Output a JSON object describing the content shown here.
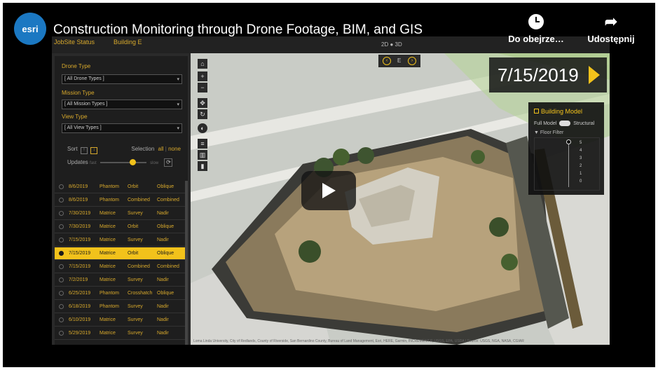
{
  "video": {
    "title": "Construction Monitoring through Drone Footage, BIM, and GIS",
    "logo_text": "esri",
    "watch_later_label": "Do obejrze…",
    "share_label": "Udostępnij"
  },
  "app": {
    "subtitle_left": "JobSite Status",
    "subtitle_right": "Building E",
    "view_toggle": "2D ● 3D"
  },
  "filters": [
    {
      "label": "Drone Type",
      "value": "[ All Drone Types ]"
    },
    {
      "label": "Mission Type",
      "value": "[ All Mission Types ]"
    },
    {
      "label": "View Type",
      "value": "[ All View Types ]"
    }
  ],
  "sort": {
    "label": "Sort",
    "selection_label": "Selection",
    "all": "all",
    "none": "none",
    "updates_label": "Updates",
    "updates_left": "fast",
    "updates_right": "slow",
    "updates_level": 0.7
  },
  "table_rows": [
    {
      "date": "8/6/2019",
      "drone": "Phantom",
      "mission": "Orbit",
      "view": "Oblique",
      "selected": false
    },
    {
      "date": "8/6/2019",
      "drone": "Phantom",
      "mission": "Combined",
      "view": "Combined",
      "selected": false
    },
    {
      "date": "7/30/2019",
      "drone": "Matrice",
      "mission": "Survey",
      "view": "Nadir",
      "selected": false
    },
    {
      "date": "7/30/2019",
      "drone": "Matrice",
      "mission": "Orbit",
      "view": "Oblique",
      "selected": false
    },
    {
      "date": "7/15/2019",
      "drone": "Matrice",
      "mission": "Survey",
      "view": "Nadir",
      "selected": false
    },
    {
      "date": "7/15/2019",
      "drone": "Matrice",
      "mission": "Orbit",
      "view": "Oblique",
      "selected": true
    },
    {
      "date": "7/15/2019",
      "drone": "Matrice",
      "mission": "Combined",
      "view": "Combined",
      "selected": false
    },
    {
      "date": "7/2/2019",
      "drone": "Matrice",
      "mission": "Survey",
      "view": "Nadir",
      "selected": false
    },
    {
      "date": "6/25/2019",
      "drone": "Phantom",
      "mission": "Crosshatch",
      "view": "Oblique",
      "selected": false
    },
    {
      "date": "6/18/2019",
      "drone": "Phantom",
      "mission": "Survey",
      "view": "Nadir",
      "selected": false
    },
    {
      "date": "6/10/2019",
      "drone": "Matrice",
      "mission": "Survey",
      "view": "Nadir",
      "selected": false
    },
    {
      "date": "5/29/2019",
      "drone": "Matrice",
      "mission": "Survey",
      "view": "Nadir",
      "selected": false
    }
  ],
  "map": {
    "current_date": "7/15/2019",
    "compass_label": "E",
    "attribution": "Loma Linda University, City of Redlands, County of Riverside, San Bernardino County, Bureau of Land Management, Esri, HERE, Garmin, INCREMENT P, USGS, EPA, USDA | Source: USGS, NGA, NASA, CGIAR"
  },
  "building_model": {
    "title": "Building Model",
    "full_label": "Full Model",
    "structural_label": "Structural",
    "floor_filter_label": "Floor Filter",
    "floors": [
      "5",
      "4",
      "3",
      "2",
      "1",
      "0"
    ]
  },
  "colors": {
    "accent": "#f2c21b",
    "text_gold": "#d8a92c",
    "panel_bg": "#1e1e1e",
    "esri_blue": "#1b78c2"
  }
}
